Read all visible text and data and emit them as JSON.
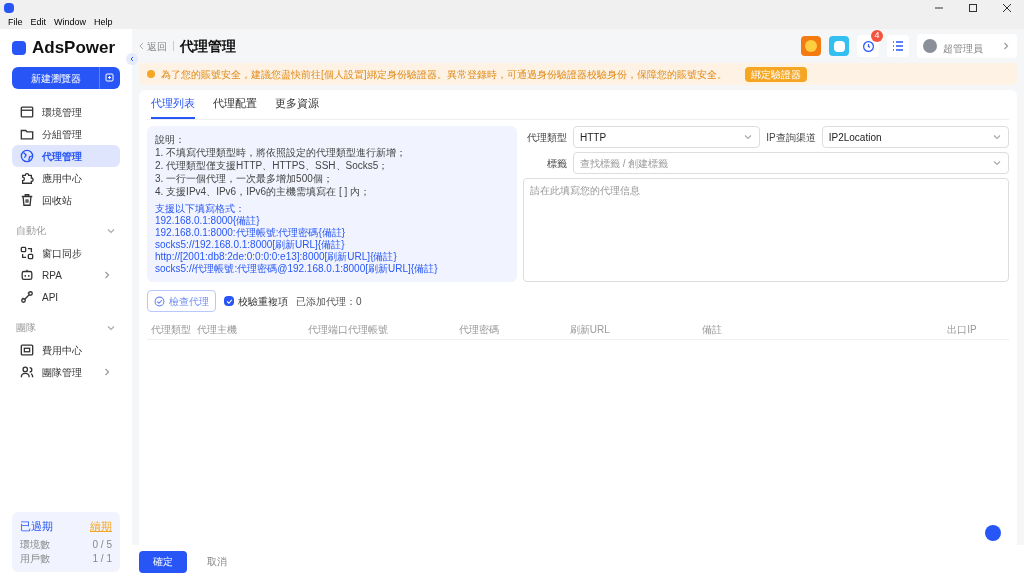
{
  "menu": [
    "File",
    "Edit",
    "Window",
    "Help"
  ],
  "sidebar": {
    "logo": "AdsPower",
    "new_button": "新建瀏覽器",
    "items": [
      {
        "label": "環境管理",
        "selected": false,
        "chevron": false
      },
      {
        "label": "分組管理",
        "selected": false,
        "chevron": false
      },
      {
        "label": "代理管理",
        "selected": true,
        "chevron": false
      },
      {
        "label": "應用中心",
        "selected": false,
        "chevron": false
      },
      {
        "label": "回收站",
        "selected": false,
        "chevron": false
      }
    ],
    "sections": [
      {
        "title": "自動化",
        "items": [
          {
            "label": "窗口同步",
            "selected": false,
            "chevron": false
          },
          {
            "label": "RPA",
            "selected": false,
            "chevron": true
          },
          {
            "label": "API",
            "selected": false,
            "chevron": false
          }
        ]
      },
      {
        "title": "團隊",
        "items": [
          {
            "label": "費用中心",
            "selected": false,
            "chevron": false
          },
          {
            "label": "團隊管理",
            "selected": false,
            "chevron": true
          }
        ]
      }
    ],
    "plan": {
      "status": "已過期",
      "renew": "續期",
      "rows": [
        {
          "label": "環境數",
          "value": "0 / 5"
        },
        {
          "label": "用戶數",
          "value": "1 / 1"
        }
      ]
    }
  },
  "header": {
    "back": "返回",
    "title": "代理管理",
    "badge": "4",
    "role": "超管理員"
  },
  "banner": {
    "text": "為了您的賬號安全，建議您盡快前往[個人設置]綁定身份驗證器。異常登錄時，可通過身份驗證器校驗身份，保障您的賬號安全。",
    "button": "綁定驗證器"
  },
  "tabs": [
    {
      "label": "代理列表",
      "selected": true
    },
    {
      "label": "代理配置",
      "selected": false
    },
    {
      "label": "更多資源",
      "selected": false
    }
  ],
  "notes": {
    "lines": [
      "說明：",
      "1. 不填寫代理類型時，將依照設定的代理類型進行新增；",
      "2. 代理類型僅支援HTTP、HTTPS、SSH、Socks5；",
      "3. 一行一個代理，一次最多增加500個；",
      "4. 支援IPv4、IPv6，IPv6的主機需填寫在 [ ] 內；"
    ],
    "formats_title": "支援以下填寫格式：",
    "formats": [
      "192.168.0.1:8000{備註}",
      "192.168.0.1:8000:代理帳號:代理密碼{備註}",
      "socks5://192.168.0.1:8000[刷新URL]{備註}",
      "http://[2001:db8:2de:0:0:0:0:e13]:8000[刷新URL]{備註}",
      "socks5://代理帳號:代理密碼@192.168.0.1:8000[刷新URL]{備註}"
    ]
  },
  "form": {
    "proxy_type_label": "代理類型",
    "proxy_type": "HTTP",
    "ip_channel_label": "IP查詢渠道",
    "ip_channel": "IP2Location",
    "tag_label": "標籤",
    "tag_placeholder": "查找標籤 / 創建標籤",
    "textarea_placeholder": "請在此填寫您的代理信息"
  },
  "toolbar": {
    "check_button": "檢查代理",
    "dedupe": {
      "label": "校驗重複項",
      "checked": true
    },
    "count": "已添加代理：0"
  },
  "table": {
    "columns": [
      "代理類型",
      "代理主機",
      "代理端口",
      "代理帳號",
      "代理密碼",
      "刷新URL",
      "備註",
      "出口IP"
    ]
  },
  "footer": {
    "ok": "確定",
    "cancel": "取消"
  }
}
